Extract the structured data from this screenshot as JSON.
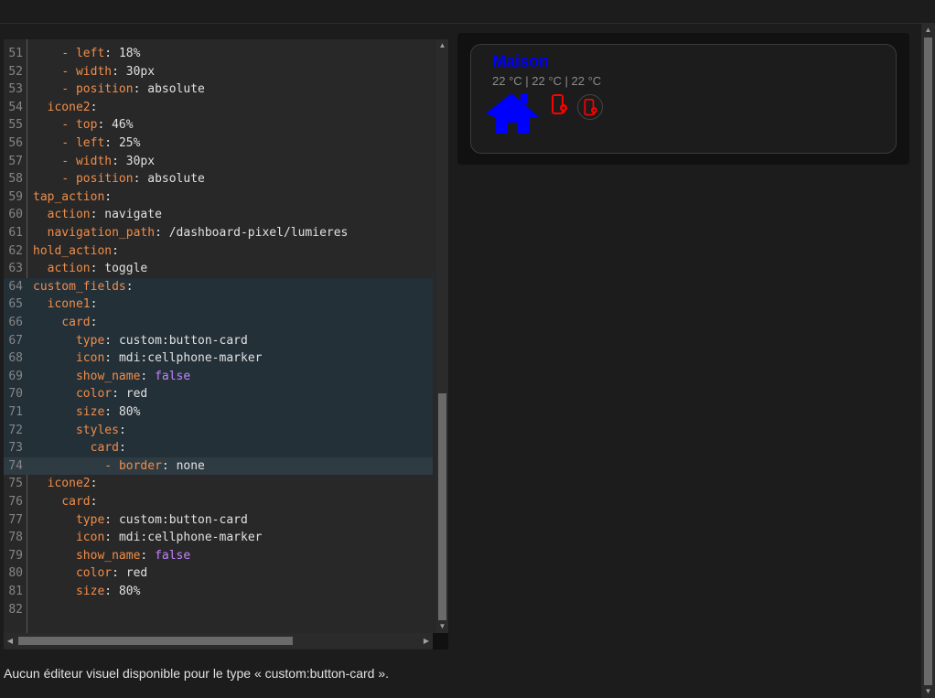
{
  "editor": {
    "lines": [
      {
        "n": "51",
        "indent": "    - ",
        "key": "left",
        "val": "18%"
      },
      {
        "n": "52",
        "indent": "    - ",
        "key": "width",
        "val": "30px"
      },
      {
        "n": "53",
        "indent": "    - ",
        "key": "position",
        "val": "absolute"
      },
      {
        "n": "54",
        "indent": "  ",
        "key": "icone2",
        "val": ""
      },
      {
        "n": "55",
        "indent": "    - ",
        "key": "top",
        "val": "46%"
      },
      {
        "n": "56",
        "indent": "    - ",
        "key": "left",
        "val": "25%"
      },
      {
        "n": "57",
        "indent": "    - ",
        "key": "width",
        "val": "30px"
      },
      {
        "n": "58",
        "indent": "    - ",
        "key": "position",
        "val": "absolute"
      },
      {
        "n": "59",
        "indent": "",
        "key": "tap_action",
        "val": ""
      },
      {
        "n": "60",
        "indent": "  ",
        "key": "action",
        "val": "navigate"
      },
      {
        "n": "61",
        "indent": "  ",
        "key": "navigation_path",
        "val": "/dashboard-pixel/lumieres"
      },
      {
        "n": "62",
        "indent": "",
        "key": "hold_action",
        "val": ""
      },
      {
        "n": "63",
        "indent": "  ",
        "key": "action",
        "val": "toggle"
      },
      {
        "n": "64",
        "indent": "",
        "key": "custom_fields",
        "val": ""
      },
      {
        "n": "65",
        "indent": "  ",
        "key": "icone1",
        "val": ""
      },
      {
        "n": "66",
        "indent": "    ",
        "key": "card",
        "val": ""
      },
      {
        "n": "67",
        "indent": "      ",
        "key": "type",
        "val": "custom:button-card"
      },
      {
        "n": "68",
        "indent": "      ",
        "key": "icon",
        "val": "mdi:cellphone-marker"
      },
      {
        "n": "69",
        "indent": "      ",
        "key": "show_name",
        "val": "false"
      },
      {
        "n": "70",
        "indent": "      ",
        "key": "color",
        "val": "red"
      },
      {
        "n": "71",
        "indent": "      ",
        "key": "size",
        "val": "80%"
      },
      {
        "n": "72",
        "indent": "      ",
        "key": "styles",
        "val": ""
      },
      {
        "n": "73",
        "indent": "        ",
        "key": "card",
        "val": ""
      },
      {
        "n": "74",
        "indent": "          - ",
        "key": "border",
        "val": "none"
      },
      {
        "n": "75",
        "indent": "  ",
        "key": "icone2",
        "val": ""
      },
      {
        "n": "76",
        "indent": "    ",
        "key": "card",
        "val": ""
      },
      {
        "n": "77",
        "indent": "      ",
        "key": "type",
        "val": "custom:button-card"
      },
      {
        "n": "78",
        "indent": "      ",
        "key": "icon",
        "val": "mdi:cellphone-marker"
      },
      {
        "n": "79",
        "indent": "      ",
        "key": "show_name",
        "val": "false"
      },
      {
        "n": "80",
        "indent": "      ",
        "key": "color",
        "val": "red"
      },
      {
        "n": "81",
        "indent": "      ",
        "key": "size",
        "val": "80%"
      },
      {
        "n": "82",
        "indent": "",
        "key": "",
        "val": ""
      }
    ],
    "selected_from": "64",
    "selected_to": "74",
    "active_line": "74"
  },
  "message": "Aucun éditeur visuel disponible pour le type « custom:button-card ».",
  "preview": {
    "name": "Maison",
    "state": "22 °C | 22 °C | 22 °C",
    "name_color": "#0000ff",
    "house_icon": "home-icon",
    "house_color": "#0000ff",
    "field_icon": "cellphone-marker-icon",
    "field_color": "#ff0000"
  },
  "colors": {
    "key": "#f08d49",
    "bool": "#c382ff",
    "selection": "#233038"
  }
}
